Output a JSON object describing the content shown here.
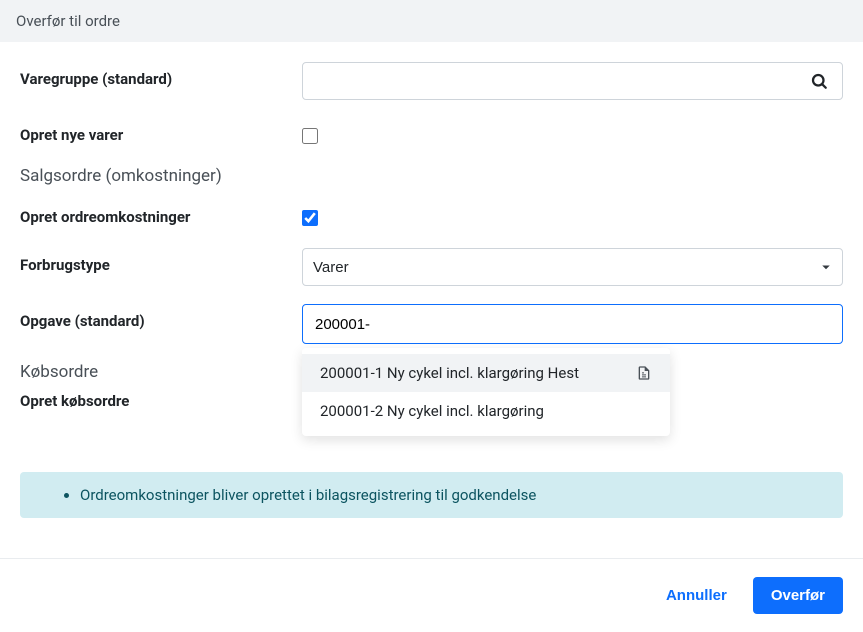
{
  "header": {
    "title": "Overfør til ordre"
  },
  "form": {
    "varegruppe": {
      "label": "Varegruppe (standard)",
      "value": ""
    },
    "opret_nye_varer": {
      "label": "Opret nye varer",
      "checked": false
    },
    "section_salgsordre": {
      "title": "Salgsordre (omkostninger)"
    },
    "opret_ordreomkostninger": {
      "label": "Opret ordreomkostninger",
      "checked": true
    },
    "forbrugstype": {
      "label": "Forbrugstype",
      "selected": "Varer"
    },
    "opgave": {
      "label": "Opgave (standard)",
      "value": "200001-",
      "suggestions": [
        {
          "label": "200001-1 Ny cykel incl. klargøring Hest",
          "has_icon": true
        },
        {
          "label": "200001-2 Ny cykel incl. klargøring",
          "has_icon": false
        }
      ]
    },
    "section_kobsordre": {
      "title": "Købsordre"
    },
    "opret_kobsordre": {
      "label": "Opret købsordre"
    }
  },
  "info": {
    "message": "Ordreomkostninger bliver oprettet i bilagsregistrering til godkendelse"
  },
  "footer": {
    "cancel": "Annuller",
    "submit": "Overfør"
  }
}
